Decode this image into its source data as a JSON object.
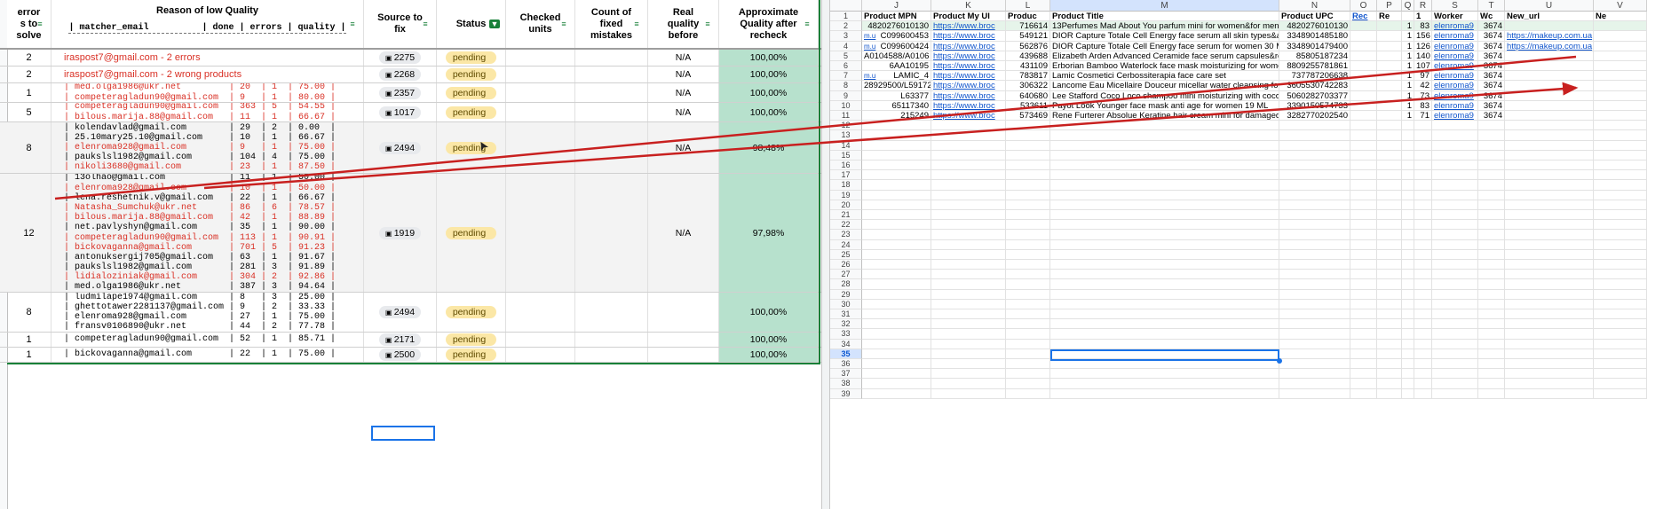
{
  "left": {
    "headers": {
      "errors_to_solve": "error\ns to\nsolve",
      "reason": "Reason of low Quality",
      "reason_sub": "| matcher_email          | done | errors | quality |",
      "source": "Source to\nfix",
      "status": "Status",
      "checked": "Checked\nunits",
      "fixed": "Count of\nfixed\nmistakes",
      "real_quality": "Real\nquality\nbefore",
      "approx_quality": "Approximate\nQuality after\nrecheck"
    },
    "rows": [
      {
        "errors": "2",
        "reason_text": "iraspost7@gmail.com - 2 errors",
        "lines": [],
        "source": "2275",
        "status": "pending",
        "real": "N/A",
        "approx": "100,00%"
      },
      {
        "errors": "2",
        "reason_text": "iraspost7@gmail.com  - 2 wrong products",
        "lines": [],
        "source": "2268",
        "status": "pending",
        "real": "N/A",
        "approx": "100,00%"
      },
      {
        "errors": "1",
        "reason_text": "",
        "lines": [
          {
            "t": "| med.olga1986@ukr.net         | 20  | 1  | 75.00 |",
            "red": true
          },
          {
            "t": "| competeragladun90@gmail.com  | 9   | 1  | 80.00 |",
            "red": true
          }
        ],
        "source": "2357",
        "status": "pending",
        "real": "N/A",
        "approx": "100,00%"
      },
      {
        "errors": "5",
        "reason_text": "",
        "lines": [
          {
            "t": "| competeragladun90@gmail.com  | 363 | 5  | 54.55 |",
            "red": true
          },
          {
            "t": "| bilous.marija.88@gmail.com   | 11  | 1  | 66.67 |",
            "red": true
          }
        ],
        "source": "1017",
        "status": "pending",
        "real": "N/A",
        "approx": "100,00%"
      },
      {
        "errors": "8",
        "reason_text": "",
        "lines": [
          {
            "t": "| kolendavlad@gmail.com        | 29  | 2  | 0.00  |",
            "red": false
          },
          {
            "t": "| 25.10mary25.10@gmail.com     | 10  | 1  | 66.67 |",
            "red": false
          },
          {
            "t": "| elenroma928@gmail.com        | 9   | 1  | 75.00 |",
            "red": true
          },
          {
            "t": "| paukslsl1982@gmail.com       | 104 | 4  | 75.00 |",
            "red": false
          },
          {
            "t": "| nikoli3680@gmail.com         | 23  | 1  | 87.50 |",
            "red": true
          }
        ],
        "source": "2494",
        "status": "pending",
        "real": "N/A",
        "approx": "98,48%"
      },
      {
        "errors": "12",
        "reason_text": "",
        "lines": [
          {
            "t": "| 13olhao@gmail.com            | 11  | 1  | 50.00 |",
            "red": false
          },
          {
            "t": "| elenroma928@gmail.com        | 10  | 1  | 50.00 |",
            "red": true
          },
          {
            "t": "| lena.reshetnik.v@gmail.com   | 22  | 1  | 66.67 |",
            "red": false
          },
          {
            "t": "| Natasha_Sumchuk@ukr.net      | 86  | 6  | 78.57 |",
            "red": true
          },
          {
            "t": "| bilous.marija.88@gmail.com   | 42  | 1  | 88.89 |",
            "red": true
          },
          {
            "t": "| net.pavlyshyn@gmail.com      | 35  | 1  | 90.00 |",
            "red": false
          },
          {
            "t": "| competeragladun90@gmail.com  | 113 | 1  | 90.91 |",
            "red": true
          },
          {
            "t": "| bickovaganna@gmail.com       | 701 | 5  | 91.23 |",
            "red": true
          },
          {
            "t": "| antonuksergij705@gmail.com   | 63  | 1  | 91.67 |",
            "red": false
          },
          {
            "t": "| paukslsl1982@gmail.com       | 281 | 3  | 91.89 |",
            "red": false
          },
          {
            "t": "| lidialoziniak@gmail.com      | 304 | 2  | 92.86 |",
            "red": true
          },
          {
            "t": "| med.olga1986@ukr.net         | 387 | 3  | 94.64 |",
            "red": false
          }
        ],
        "source": "1919",
        "status": "pending",
        "real": "N/A",
        "approx": "97,98%"
      },
      {
        "errors": "8",
        "reason_text": "",
        "lines": [
          {
            "t": "| ludmilape1974@gmail.com      | 8   | 3  | 25.00 |",
            "red": false
          },
          {
            "t": "| ghettotawer2281137@gmail.com | 9   | 2  | 33.33 |",
            "red": false
          },
          {
            "t": "| elenroma928@gmail.com        | 27  | 1  | 75.00 |",
            "red": false
          },
          {
            "t": "| fransv0106890@ukr.net        | 44  | 2  | 77.78 |",
            "red": false
          }
        ],
        "source": "2494",
        "status": "pending",
        "real": "",
        "approx": "100,00%"
      },
      {
        "errors": "1",
        "reason_text": "",
        "lines": [
          {
            "t": "| competeragladun90@gmail.com  | 52  | 1  | 85.71 |",
            "red": false
          }
        ],
        "source": "2171",
        "status": "pending",
        "real": "",
        "approx": "100,00%"
      },
      {
        "errors": "1",
        "reason_text": "",
        "lines": [
          {
            "t": "| bickovaganna@gmail.com       | 22  | 1  | 75.00 |",
            "red": false
          }
        ],
        "source": "2500",
        "status": "pending",
        "real": "",
        "approx": "100,00%"
      }
    ]
  },
  "right": {
    "col_letters": [
      "J",
      "K",
      "L",
      "M",
      "N",
      "O",
      "P",
      "Q",
      "R",
      "S",
      "T",
      "U",
      "V"
    ],
    "headers": [
      "Product MPN",
      "Product My Ul",
      "Produc",
      "Product Title",
      "Product UPC",
      "Rec",
      "Re",
      "",
      "1",
      "Worker",
      "Wc",
      "New_url",
      "Ne"
    ],
    "rows": [
      [
        "4820276010130",
        "https://www.broc",
        "716614",
        "13Perfumes Mad About You parfum mini for women&for men 10 ML",
        "4820276010130",
        "",
        "",
        "1",
        "83",
        "elenroma9",
        "3674",
        "",
        ""
      ],
      [
        "C099600453",
        "https://www.broc",
        "549121",
        "DIOR Capture Totale Cell Energy face serum all skin types&anti age&n",
        "3348901485180",
        "",
        "",
        "1",
        "156",
        "elenroma9",
        "3674",
        "https://makeup.com.ua",
        ""
      ],
      [
        "C099600424",
        "https://www.broc",
        "562876",
        "DIOR Capture Totale Cell Energy face serum for women 30 ML",
        "3348901479400",
        "",
        "",
        "1",
        "126",
        "elenroma9",
        "3674",
        "https://makeup.com.ua",
        ""
      ],
      [
        "A0104588/A0106",
        "https://www.broc",
        "439688",
        "Elizabeth Arden Advanced Ceramide face serum capsules&repair&wi",
        "85805187234",
        "",
        "",
        "1",
        "140",
        "elenroma9",
        "3674",
        "",
        ""
      ],
      [
        "6AA10195",
        "https://www.broc",
        "431109",
        "Erborian Bamboo Waterlock face mask moisturizing for women 30 Ml",
        "8809255781861",
        "",
        "",
        "1",
        "107",
        "elenroma9",
        "3674",
        "",
        ""
      ],
      [
        "LAMIC_4",
        "https://www.broc",
        "783817",
        "Lamic Cosmetici Cerbossiterapia face care set",
        "737787206638",
        "",
        "",
        "1",
        "97",
        "elenroma9",
        "3674",
        "",
        ""
      ],
      [
        "28929500/L59172",
        "https://www.broc",
        "306322",
        "Lancome Eau Micellaire Douceur micellar water cleansing for women",
        "3605530742283",
        "",
        "",
        "1",
        "42",
        "elenroma9",
        "3674",
        "",
        ""
      ],
      [
        "L63377",
        "https://www.broc",
        "640680",
        "Lee Stafford Coco Loco shampoo mini moisturizing with coconut oil fo",
        "5060282703377",
        "",
        "",
        "1",
        "73",
        "elenroma9",
        "3674",
        "",
        ""
      ],
      [
        "65117340",
        "https://www.broc",
        "533611",
        "Payot Look Younger face mask anti age for women 19 ML",
        "3390150574733",
        "",
        "",
        "1",
        "83",
        "elenroma9",
        "3674",
        "",
        ""
      ],
      [
        "215249",
        "https://www.broc",
        "573469",
        "Rene Furterer Absolue Keratine hair cream mini for damaged hair&lea",
        "3282770202540",
        "",
        "",
        "1",
        "71",
        "elenroma9",
        "3674",
        "",
        ""
      ]
    ],
    "row_numbers": [
      "1",
      "2",
      "3",
      "4",
      "5",
      "6",
      "7",
      "8",
      "9",
      "10",
      "11",
      "12",
      "13",
      "14",
      "15",
      "16",
      "17",
      "18",
      "19",
      "20",
      "21",
      "22",
      "23",
      "24",
      "25",
      "26",
      "27",
      "28",
      "29",
      "30",
      "31",
      "32",
      "33",
      "34",
      "35",
      "36",
      "37",
      "38",
      "39"
    ],
    "row_prefixes": [
      "",
      "m.u",
      "m.u",
      "",
      "",
      "m.u",
      "",
      "",
      "",
      ""
    ]
  },
  "colors": {
    "pending_chip": "#fbe7a6",
    "quality_fill": "#b7e1cd",
    "selection": "#1a73e8",
    "annotation": "#c8201f"
  }
}
